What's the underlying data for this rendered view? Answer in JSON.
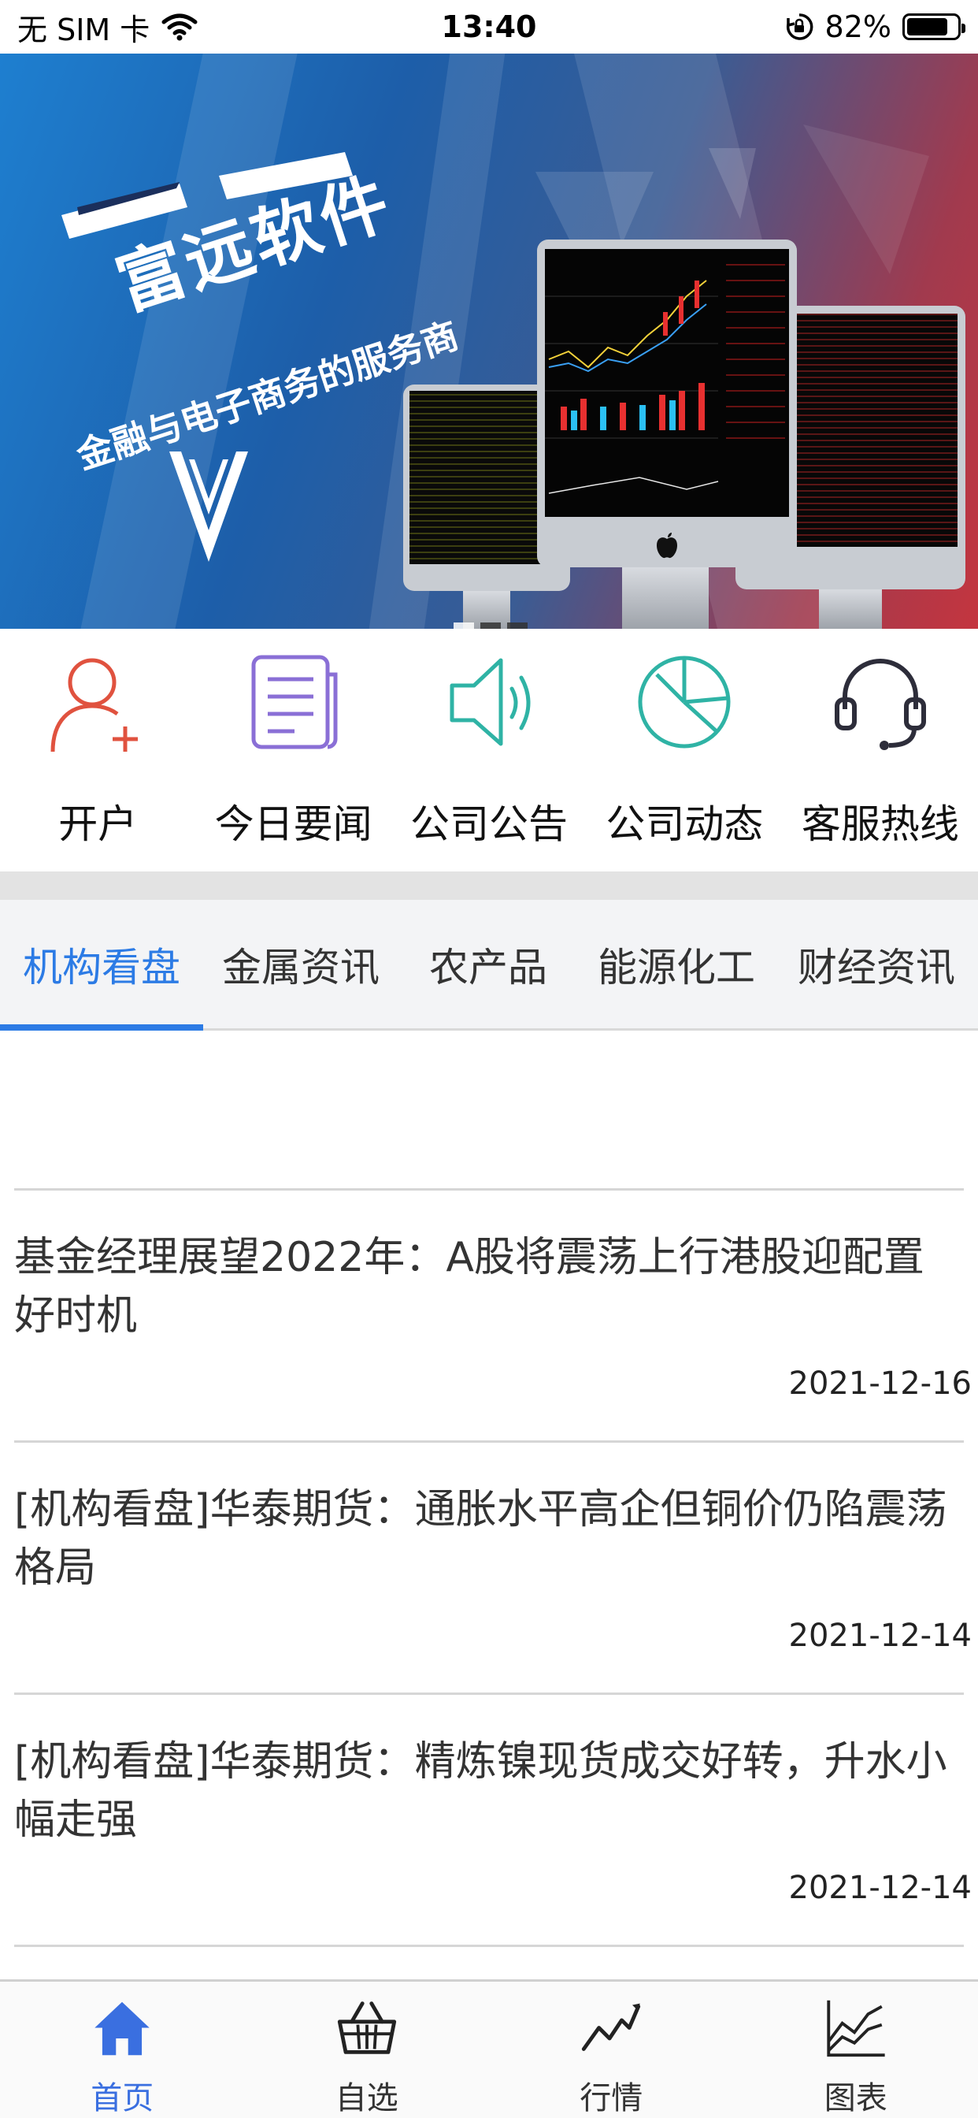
{
  "status_bar": {
    "carrier": "无 SIM 卡",
    "time": "13:40",
    "battery_percent": "82%",
    "battery_level": 0.82,
    "icons": [
      "wifi-icon",
      "rotation-lock-icon",
      "battery-icon"
    ]
  },
  "banner": {
    "title": "富远软件",
    "subtitle": "金融与电子商务的服务商",
    "slide_count": 3,
    "active_slide": 0
  },
  "quick_actions": [
    {
      "label": "开户",
      "icon": "add-user-icon",
      "color": "#e0523f"
    },
    {
      "label": "今日要闻",
      "icon": "document-icon",
      "color": "#8a6fd6"
    },
    {
      "label": "公司公告",
      "icon": "speaker-icon",
      "color": "#2fb3a5"
    },
    {
      "label": "公司动态",
      "icon": "pie-chart-icon",
      "color": "#2fb3a5"
    },
    {
      "label": "客服热线",
      "icon": "headset-icon",
      "color": "#2d2d3a"
    }
  ],
  "tabs": [
    {
      "label": "机构看盘",
      "active": true
    },
    {
      "label": "金属资讯",
      "active": false
    },
    {
      "label": "农产品",
      "active": false
    },
    {
      "label": "能源化工",
      "active": false
    },
    {
      "label": "财经资讯",
      "active": false
    }
  ],
  "news": [
    {
      "title": "基金经理展望2022年：A股将震荡上行港股迎配置好时机",
      "date": "2021-12-16"
    },
    {
      "title": "[机构看盘]华泰期货：通胀水平高企但铜价仍陷震荡格局",
      "date": "2021-12-14"
    },
    {
      "title": "[机构看盘]华泰期货：精炼镍现货成交好转，升水小幅走强",
      "date": "2021-12-14"
    }
  ],
  "bottom_nav": [
    {
      "label": "首页",
      "icon": "home-icon",
      "active": true
    },
    {
      "label": "自选",
      "icon": "basket-icon",
      "active": false
    },
    {
      "label": "行情",
      "icon": "trend-icon",
      "active": false
    },
    {
      "label": "图表",
      "icon": "chart-icon",
      "active": false
    }
  ],
  "colors": {
    "accent": "#2c7be5",
    "nav_active": "#3a6fe0"
  }
}
